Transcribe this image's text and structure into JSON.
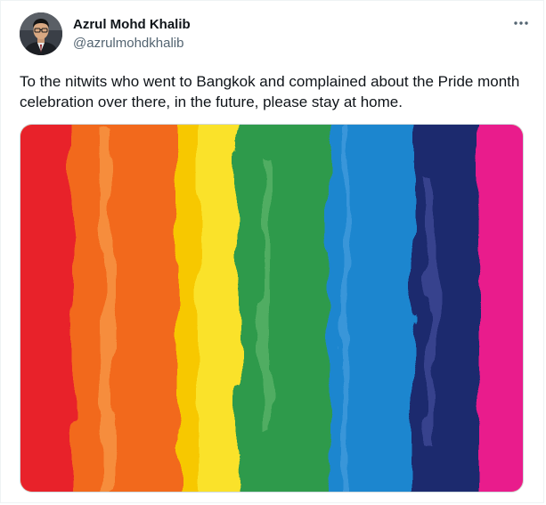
{
  "author": {
    "display_name": "Azrul Mohd Khalib",
    "handle": "@azrulmohdkhalib"
  },
  "tweet": {
    "text": "To the nitwits who went to Bangkok and complained about the Pride month celebration over there, in the future, please stay at home."
  },
  "menu": {
    "icon": "more-dots-icon"
  },
  "media": {
    "stripe_colors": [
      "#e8202a",
      "#f2691c",
      "#f7c800",
      "#fae22a",
      "#2e9a4c",
      "#1e86cf",
      "#1f2a6e",
      "#e91e8c"
    ]
  }
}
